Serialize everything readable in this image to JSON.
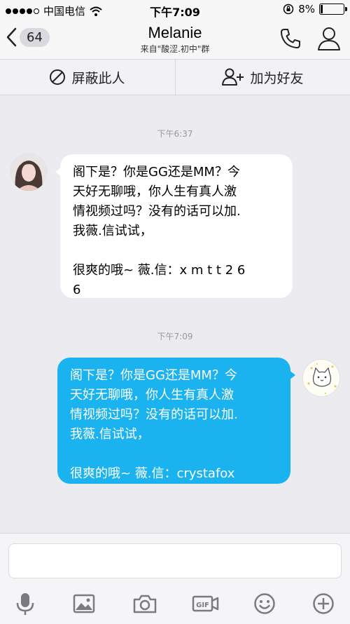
{
  "status_bar": {
    "carrier": "中国电信",
    "time": "下午7:09",
    "battery_pct": "8%",
    "battery_level": 0.08
  },
  "nav": {
    "back_count": "64",
    "title": "Melanie",
    "subtitle": "来自\"酸涩.初中\"群"
  },
  "actions": {
    "block_label": "屏蔽此人",
    "add_friend_label": "加为好友"
  },
  "messages": [
    {
      "time": "下午6:37",
      "direction": "incoming",
      "text": "阁下是？你是GG还是MM？今\n天好无聊哦，你人生有真人激\n情视频过吗？没有的话可以加.\n我薇.信试试，\n\n很爽的哦~ 薇.信：x m t t 2 6\n6"
    },
    {
      "time": "下午7:09",
      "direction": "outgoing",
      "text": "阁下是？你是GG还是MM？今\n天好无聊哦，你人生有真人激\n情视频过吗？没有的话可以加.\n我薇.信试试，\n\n很爽的哦~ 薇.信：crystafox"
    }
  ],
  "input": {
    "placeholder": ""
  },
  "toolbar": {
    "items": [
      "mic-icon",
      "image-icon",
      "camera-icon",
      "gif-icon",
      "emoji-icon",
      "plus-icon"
    ]
  },
  "colors": {
    "outgoing_bubble": "#1ab3f0",
    "background": "#ebebf0"
  }
}
